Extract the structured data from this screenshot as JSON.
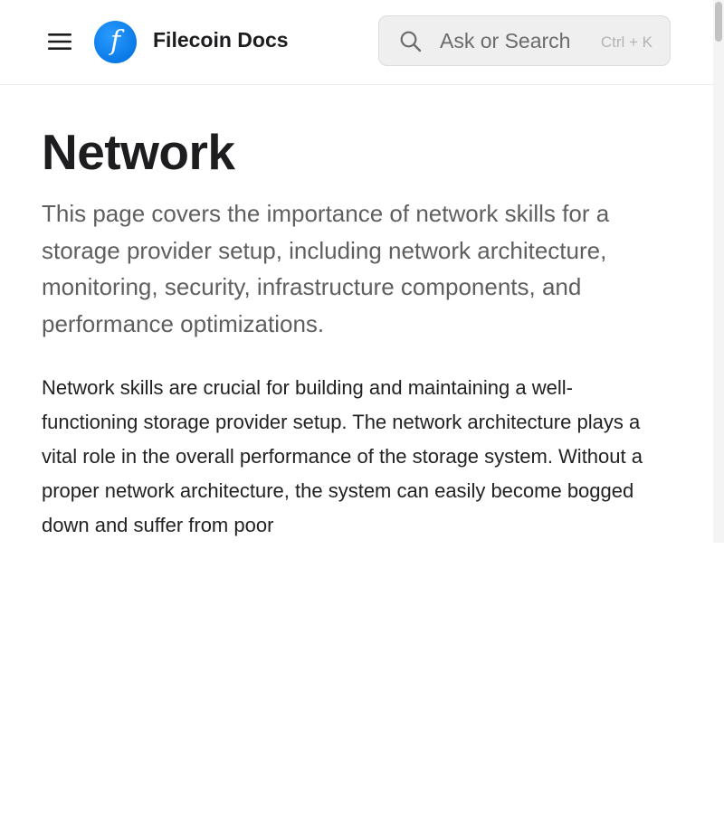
{
  "header": {
    "site_title": "Filecoin Docs",
    "logo_glyph": "f",
    "search_placeholder": "Ask or Search",
    "search_shortcut": "Ctrl + K"
  },
  "icons": {
    "menu": "hamburger-menu-icon",
    "logo": "filecoin-logo",
    "search": "magnifier-search-icon"
  },
  "colors": {
    "logo_blue": "#0a7ae8",
    "title": "#1d1d1f",
    "lead_text": "#5f5f5f",
    "search_bg": "#efefef"
  },
  "page": {
    "title": "Network",
    "lead": "This page covers the importance of network skills for a storage provider setup, including network architecture, monitoring, security, infrastructure components, and performance optimizations.",
    "body": "Network skills are crucial for building and maintaining a well-functioning storage provider setup. The network architecture plays a vital role in the overall performance of the storage system. Without a proper network architecture, the system can easily become bogged down and suffer from poor"
  }
}
